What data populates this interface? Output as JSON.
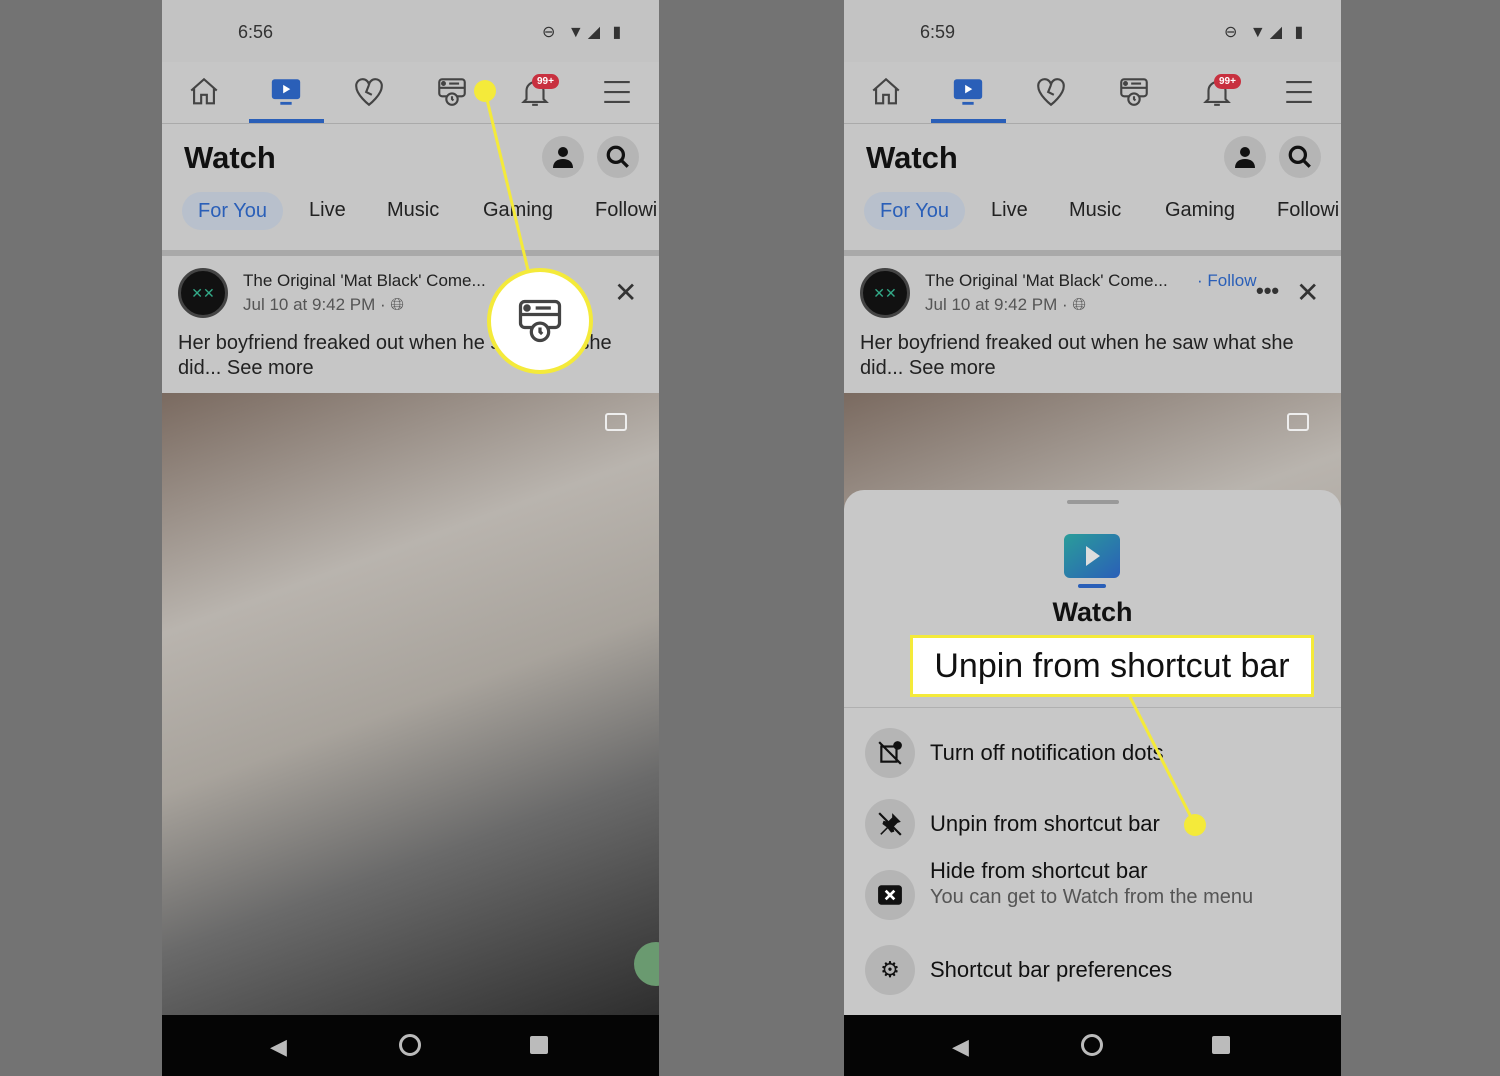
{
  "accent_color": "#2a5fb8",
  "highlight_color": "#f4ea3a",
  "nav_icons": [
    "home-icon",
    "watch-icon",
    "dating-heart-icon",
    "memories-icon",
    "notifications-bell-icon",
    "menu-icon"
  ],
  "notification_badge": "99+",
  "page_title": "Watch",
  "tabs": [
    "For You",
    "Live",
    "Music",
    "Gaming",
    "Followi"
  ],
  "post": {
    "author": "The Original 'Mat Black' Come...",
    "follow": "Follow",
    "date": "Jul 10 at 9:42 PM · ",
    "text": "Her boyfriend freaked out when he saw what she did... See more"
  },
  "left": {
    "time": "6:56"
  },
  "right": {
    "time": "6:59"
  },
  "sheet": {
    "title": "Watch",
    "callout": "Unpin from shortcut bar",
    "items": [
      {
        "icon": "notification-dots-off-icon",
        "label": "Turn off notification dots"
      },
      {
        "icon": "unpin-icon",
        "label": "Unpin from shortcut bar"
      },
      {
        "icon": "hide-icon",
        "label": "Hide from shortcut bar",
        "sub": "You can get to Watch from the menu"
      },
      {
        "icon": "gears-icon",
        "label": "Shortcut bar preferences"
      }
    ]
  }
}
